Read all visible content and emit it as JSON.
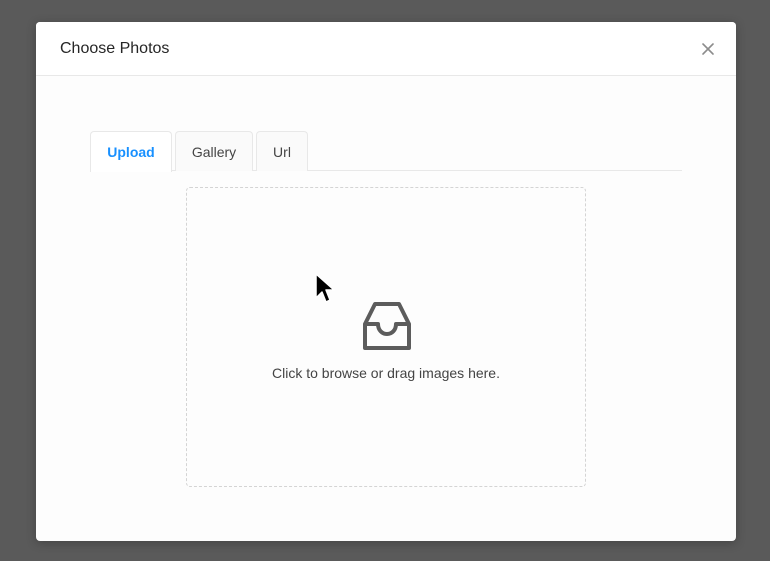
{
  "modal": {
    "title": "Choose Photos",
    "close_icon": "close-icon"
  },
  "tabs": [
    {
      "label": "Upload",
      "active": true
    },
    {
      "label": "Gallery",
      "active": false
    },
    {
      "label": "Url",
      "active": false
    }
  ],
  "dropzone": {
    "icon": "inbox-icon",
    "text": "Click to browse or drag images here."
  },
  "colors": {
    "accent": "#1890ff",
    "backdrop": "#5a5a5a"
  }
}
